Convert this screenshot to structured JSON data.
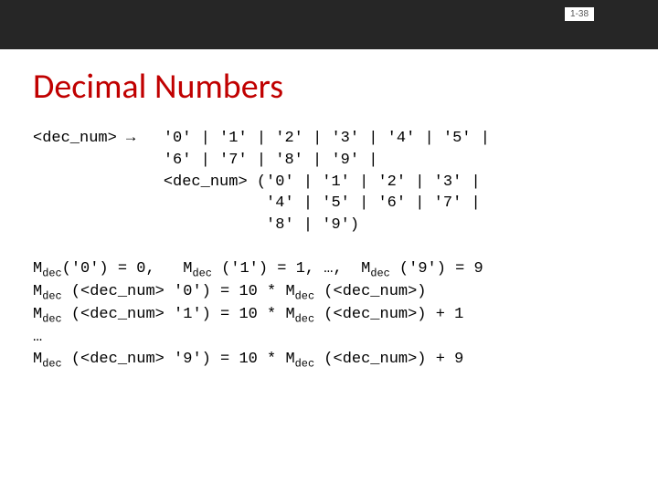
{
  "pagenum": "1-38",
  "title": "Decimal Numbers",
  "grammar": {
    "lhs": "<dec_num>",
    "arrow": "→",
    "lines": [
      "'0' | '1' | '2' | '3' | '4' | '5' |",
      "'6' | '7' | '8' | '9' |",
      "<dec_num> ('0' | '1' | '2' | '3' |",
      "           '4' | '5' | '6' | '7' |",
      "           '8' | '9')"
    ]
  },
  "semantics": {
    "line1": {
      "pre1": "M",
      "sub1": "dec",
      "mid1": "('0') = 0,   M",
      "sub2": "dec",
      "mid2": " ('1') = 1, …,  M",
      "sub3": "dec",
      "post": " ('9') = 9"
    },
    "lines_rest": [
      {
        "sub1": "dec",
        "mid1": " (<dec_num> '0') = 10 * M",
        "sub2": "dec",
        "post": " (<dec_num>)"
      },
      {
        "sub1": "dec",
        "mid1": " (<dec_num> '1') = 10 * M",
        "sub2": "dec",
        "post": " (<dec_num>) + 1"
      }
    ],
    "ellipsis": "…",
    "last": {
      "sub1": "dec",
      "mid1": " (<dec_num> '9') = 10 * M",
      "sub2": "dec",
      "post": " (<dec_num>) + 9"
    }
  }
}
